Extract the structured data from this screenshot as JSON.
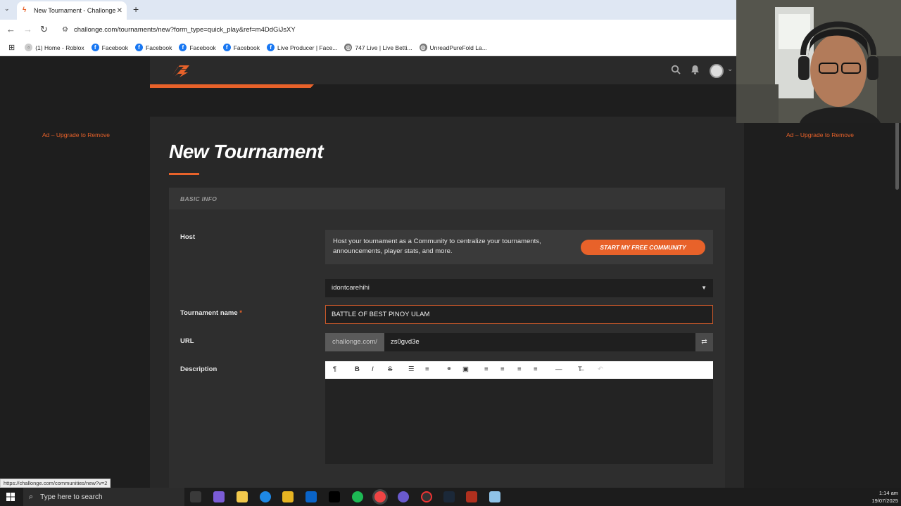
{
  "browser": {
    "tab_title": "New Tournament - Challonge",
    "tab_close": "✕",
    "new_tab": "+",
    "url": "challonge.com/tournaments/new?form_type=quick_play&ref=m4DdGiJsXY",
    "bookmarks": [
      {
        "label": "(1) Home - Roblox",
        "icon": "roblox-icon"
      },
      {
        "label": "Facebook",
        "icon": "facebook-icon"
      },
      {
        "label": "Facebook",
        "icon": "facebook-icon"
      },
      {
        "label": "Facebook",
        "icon": "facebook-icon"
      },
      {
        "label": "Facebook",
        "icon": "facebook-icon"
      },
      {
        "label": "Live Producer | Face...",
        "icon": "facebook-icon"
      },
      {
        "label": "747 Live | Live Betti...",
        "icon": "globe-icon"
      },
      {
        "label": "UnreadPureFold La...",
        "icon": "globe-icon"
      }
    ],
    "status_url": "https://challonge.com/communities/new?v=2"
  },
  "ads": {
    "left": "Ad – Upgrade to Remove",
    "right": "Ad – Upgrade to Remove"
  },
  "page": {
    "title": "New Tournament",
    "section_header": "BASIC INFO",
    "host_label": "Host",
    "host_promo": "Host your tournament as a Community to centralize your tournaments, announcements, player stats, and more.",
    "community_button": "START MY FREE COMMUNITY",
    "host_selected": "idontcarehihi",
    "name_label": "Tournament name",
    "required_mark": "*",
    "name_value": "BATTLE OF BEST PINOY ULAM",
    "url_label": "URL",
    "url_prefix": "challonge.com/",
    "url_value": "zs0gvd3e",
    "description_label": "Description",
    "description_value": ""
  },
  "editor_toolbar": [
    "paragraph-icon",
    "bold-icon",
    "italic-icon",
    "strikethrough-icon",
    "bullet-list-icon",
    "numbered-list-icon",
    "link-icon",
    "image-icon",
    "align-left-icon",
    "align-center-icon",
    "align-right-icon",
    "align-justify-icon",
    "horizontal-rule-icon",
    "clear-format-icon",
    "undo-icon"
  ],
  "taskbar": {
    "search_placeholder": "Type here to search",
    "time": "1:14 am",
    "date": "19/07/2025"
  },
  "colors": {
    "accent": "#e8622a",
    "page_bg": "#1e1e1e",
    "card_bg": "#2e2e2e"
  }
}
